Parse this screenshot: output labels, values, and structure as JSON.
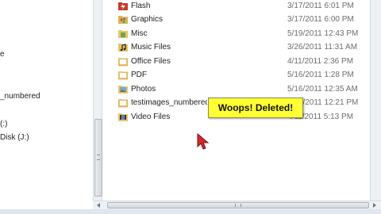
{
  "nav": {
    "items": [
      {
        "label": "e"
      },
      {
        "label": "_numbered"
      },
      {
        "label": "(:)"
      },
      {
        "label": "Disk (J:)"
      }
    ]
  },
  "files": [
    {
      "name": "Flash",
      "date": "3/17/2011 6:01 PM",
      "icon": "flash-folder-icon",
      "color": "#c83a2a"
    },
    {
      "name": "Graphics",
      "date": "3/17/2011 6:00 PM",
      "icon": "graphics-folder-icon",
      "color": "#e0b24a"
    },
    {
      "name": "Misc",
      "date": "5/19/2011 12:43 PM",
      "icon": "misc-folder-icon",
      "color": "#6aa84f"
    },
    {
      "name": "Music Files",
      "date": "3/26/2011 11:31 AM",
      "icon": "music-folder-icon",
      "color": "#e6c266"
    },
    {
      "name": "Office Files",
      "date": "4/11/2011 2:36 PM",
      "icon": "folder-icon",
      "color": "#e8c46a"
    },
    {
      "name": "PDF",
      "date": "5/16/2011 1:28 PM",
      "icon": "folder-icon",
      "color": "#e8c46a"
    },
    {
      "name": "Photos",
      "date": "5/16/2011 12:35 AM",
      "icon": "photos-folder-icon",
      "color": "#7aa6d8"
    },
    {
      "name": "testimages_numbered",
      "date": "6/17/2011 12:21 PM",
      "icon": "folder-icon",
      "color": "#e8c46a"
    },
    {
      "name": "Video Files",
      "date": "4/11/2011 5:13 PM",
      "icon": "video-folder-icon",
      "color": "#5b7fa8"
    }
  ],
  "tooltip": {
    "text": "Woops! Deleted!",
    "background": "#ffff33"
  },
  "cursor": {
    "icon": "arrow-cursor-icon",
    "color": "#d42a2a"
  }
}
